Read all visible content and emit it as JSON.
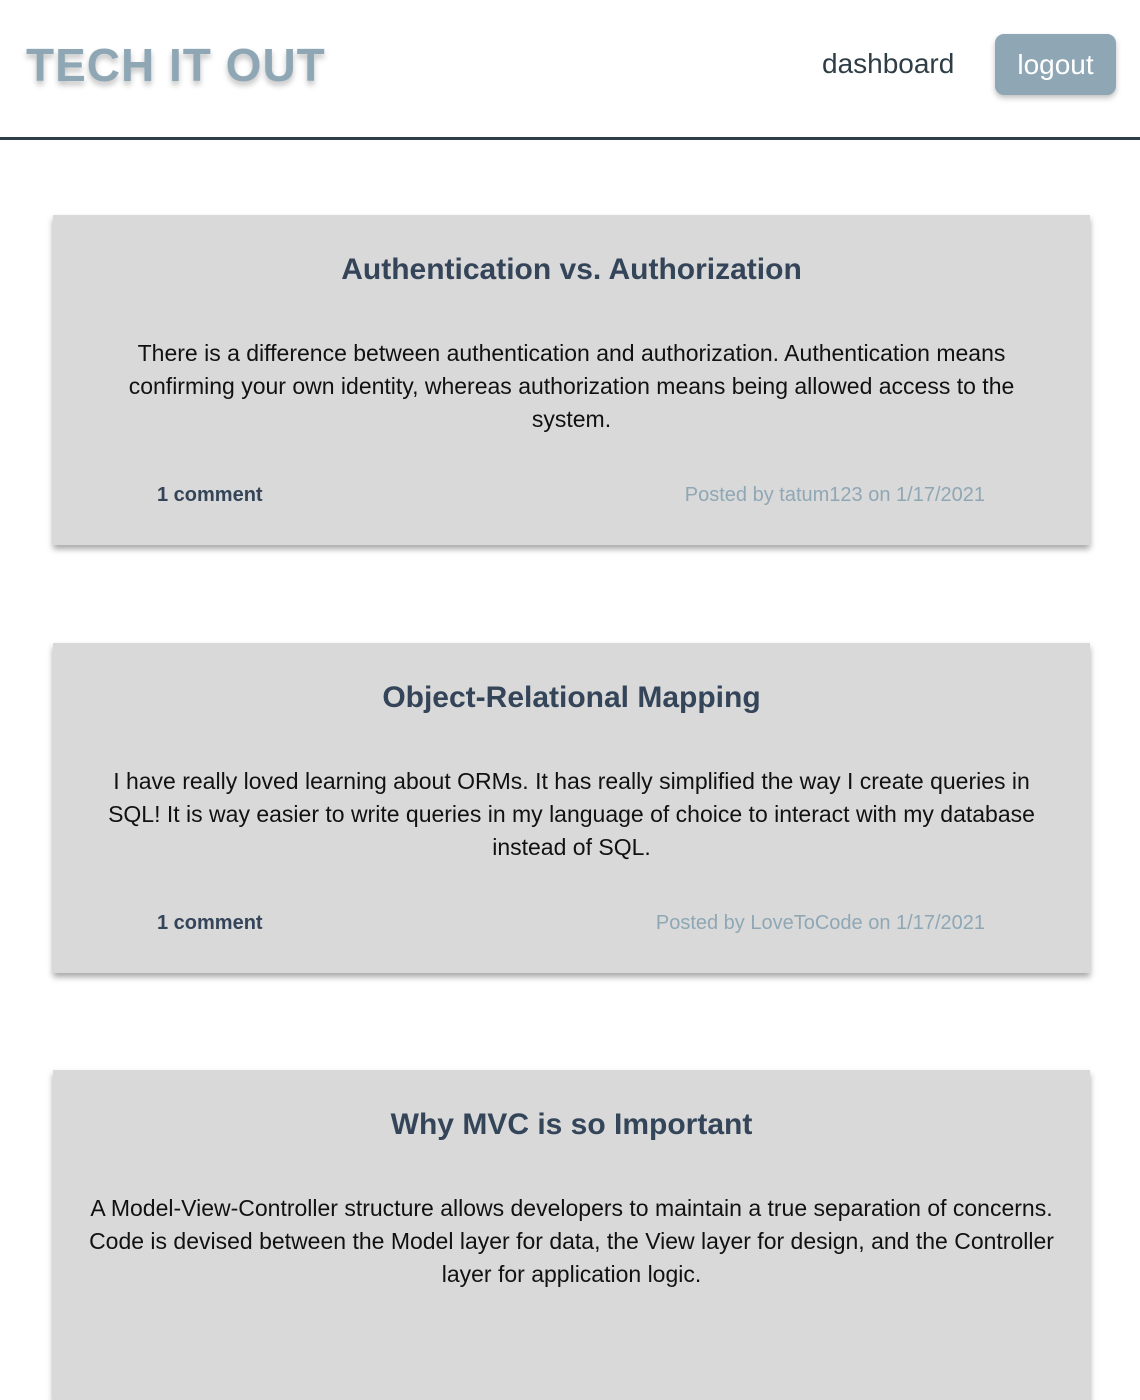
{
  "header": {
    "brand": "TECH IT OUT",
    "nav": {
      "dashboard": "dashboard",
      "logout": "logout"
    }
  },
  "posts": [
    {
      "title": "Authentication vs. Authorization",
      "body": "There is a difference between authentication and authorization. Authentication means confirming your own identity, whereas authorization means being allowed access to the system.",
      "comments": "1 comment",
      "meta": "Posted by tatum123 on 1/17/2021"
    },
    {
      "title": "Object-Relational Mapping",
      "body": "I have really loved learning about ORMs. It has really simplified the way I create queries in SQL! It is way easier to write queries in my language of choice to interact with my database instead of SQL.",
      "comments": "1 comment",
      "meta": "Posted by LoveToCode on 1/17/2021"
    },
    {
      "title": "Why MVC is so Important",
      "body": "A Model-View-Controller structure allows developers to maintain a true separation of concerns. Code is devised between the Model layer for data, the View layer for design, and the Controller layer for application logic.",
      "comments": "",
      "meta": ""
    }
  ],
  "colors": {
    "brand": "#8fa7b5",
    "dark": "#2f3e46",
    "title": "#354559",
    "card": "#d9d9d9"
  }
}
